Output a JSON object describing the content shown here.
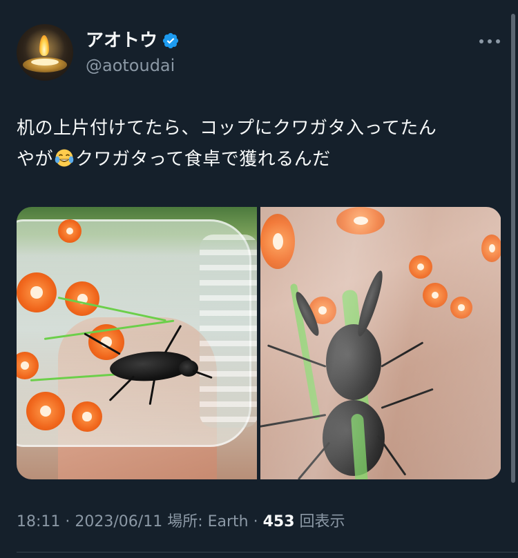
{
  "tweet": {
    "author": {
      "display_name": "アオトウ",
      "handle": "@aotoudai",
      "verified": true,
      "avatar_icon": "candle-lamp-avatar"
    },
    "text_line1": "机の上片付けてたら、コップにクワガタ入ってたん",
    "text_line2_a": "やが",
    "emoji_icon": "face-with-tears-of-joy-icon",
    "text_line2_b": "クワガタって食卓で獲れるんだ",
    "media": [
      {
        "description_icon": "photo-beetle-in-jar"
      },
      {
        "description_icon": "photo-beetle-closeup"
      }
    ],
    "meta": {
      "time": "18:11",
      "separator1": " · ",
      "date": "2023/06/11",
      "separator2": " ",
      "location": "場所: Earth",
      "separator3": " · ",
      "views_count": "453",
      "views_label": " 回表示"
    }
  },
  "colors": {
    "background": "#15202b",
    "primary_text": "#f7f9f9",
    "secondary_text": "#8b98a5",
    "verified_blue": "#1d9bf0",
    "divider": "#38444d"
  }
}
